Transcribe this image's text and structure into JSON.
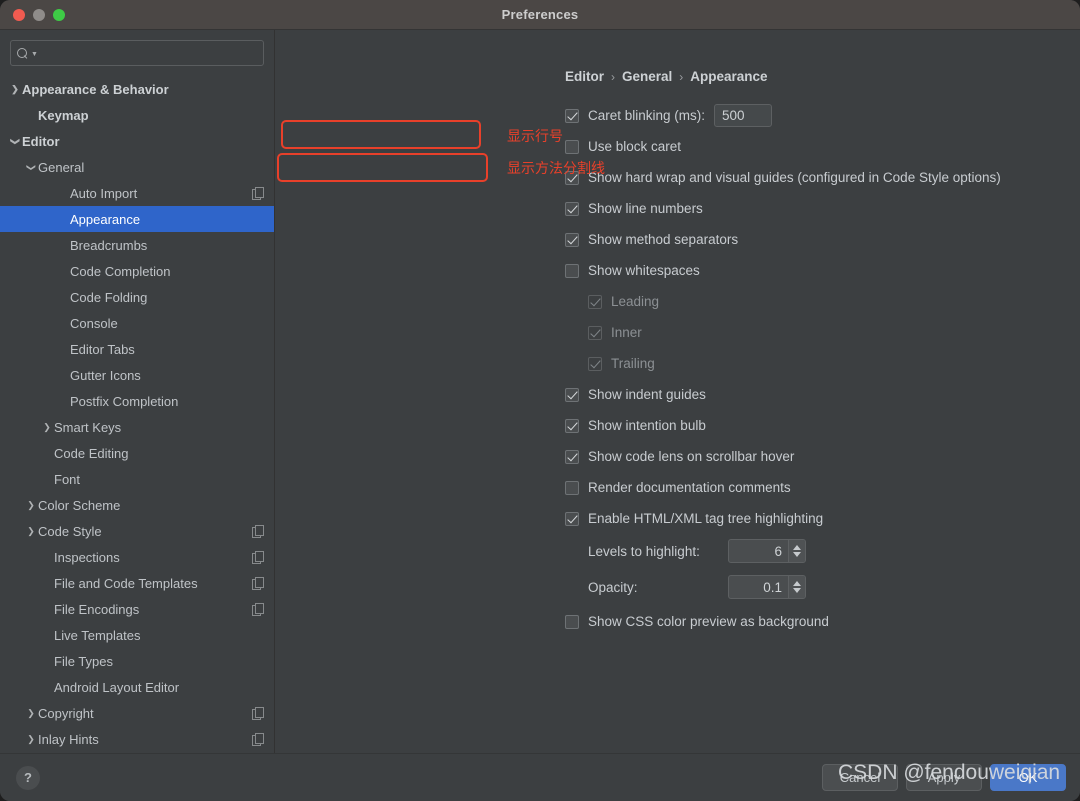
{
  "window": {
    "title": "Preferences",
    "traffic_lights": [
      "close-button",
      "minimize-button",
      "zoom-button"
    ]
  },
  "sidebar": {
    "search": {
      "value": "",
      "placeholder": ""
    },
    "items": [
      {
        "label": "Appearance & Behavior",
        "indent": 0,
        "twisty": "collapsed",
        "bold": true,
        "selected": false,
        "copy_icon": false
      },
      {
        "label": "Keymap",
        "indent": 1,
        "twisty": "none",
        "bold": true,
        "selected": false,
        "copy_icon": false
      },
      {
        "label": "Editor",
        "indent": 0,
        "twisty": "expanded",
        "bold": true,
        "selected": false,
        "copy_icon": false
      },
      {
        "label": "General",
        "indent": 1,
        "twisty": "expanded",
        "bold": false,
        "selected": false,
        "copy_icon": false
      },
      {
        "label": "Auto Import",
        "indent": 3,
        "twisty": "none",
        "bold": false,
        "selected": false,
        "copy_icon": true
      },
      {
        "label": "Appearance",
        "indent": 3,
        "twisty": "none",
        "bold": false,
        "selected": true,
        "copy_icon": false
      },
      {
        "label": "Breadcrumbs",
        "indent": 3,
        "twisty": "none",
        "bold": false,
        "selected": false,
        "copy_icon": false
      },
      {
        "label": "Code Completion",
        "indent": 3,
        "twisty": "none",
        "bold": false,
        "selected": false,
        "copy_icon": false
      },
      {
        "label": "Code Folding",
        "indent": 3,
        "twisty": "none",
        "bold": false,
        "selected": false,
        "copy_icon": false
      },
      {
        "label": "Console",
        "indent": 3,
        "twisty": "none",
        "bold": false,
        "selected": false,
        "copy_icon": false
      },
      {
        "label": "Editor Tabs",
        "indent": 3,
        "twisty": "none",
        "bold": false,
        "selected": false,
        "copy_icon": false
      },
      {
        "label": "Gutter Icons",
        "indent": 3,
        "twisty": "none",
        "bold": false,
        "selected": false,
        "copy_icon": false
      },
      {
        "label": "Postfix Completion",
        "indent": 3,
        "twisty": "none",
        "bold": false,
        "selected": false,
        "copy_icon": false
      },
      {
        "label": "Smart Keys",
        "indent": 2,
        "twisty": "collapsed",
        "bold": false,
        "selected": false,
        "copy_icon": false
      },
      {
        "label": "Code Editing",
        "indent": 2,
        "twisty": "none",
        "bold": false,
        "selected": false,
        "copy_icon": false
      },
      {
        "label": "Font",
        "indent": 2,
        "twisty": "none",
        "bold": false,
        "selected": false,
        "copy_icon": false
      },
      {
        "label": "Color Scheme",
        "indent": 1,
        "twisty": "collapsed",
        "bold": false,
        "selected": false,
        "copy_icon": false
      },
      {
        "label": "Code Style",
        "indent": 1,
        "twisty": "collapsed",
        "bold": false,
        "selected": false,
        "copy_icon": true
      },
      {
        "label": "Inspections",
        "indent": 2,
        "twisty": "none",
        "bold": false,
        "selected": false,
        "copy_icon": true
      },
      {
        "label": "File and Code Templates",
        "indent": 2,
        "twisty": "none",
        "bold": false,
        "selected": false,
        "copy_icon": true
      },
      {
        "label": "File Encodings",
        "indent": 2,
        "twisty": "none",
        "bold": false,
        "selected": false,
        "copy_icon": true
      },
      {
        "label": "Live Templates",
        "indent": 2,
        "twisty": "none",
        "bold": false,
        "selected": false,
        "copy_icon": false
      },
      {
        "label": "File Types",
        "indent": 2,
        "twisty": "none",
        "bold": false,
        "selected": false,
        "copy_icon": false
      },
      {
        "label": "Android Layout Editor",
        "indent": 2,
        "twisty": "none",
        "bold": false,
        "selected": false,
        "copy_icon": false
      },
      {
        "label": "Copyright",
        "indent": 1,
        "twisty": "collapsed",
        "bold": false,
        "selected": false,
        "copy_icon": true
      },
      {
        "label": "Inlay Hints",
        "indent": 1,
        "twisty": "collapsed",
        "bold": false,
        "selected": false,
        "copy_icon": true
      }
    ]
  },
  "main": {
    "breadcrumb": [
      "Editor",
      "General",
      "Appearance"
    ],
    "breadcrumb_separator": "›",
    "caret_blinking": {
      "label": "Caret blinking (ms):",
      "checked": true,
      "value": "500"
    },
    "options": [
      {
        "label": "Use block caret",
        "checked": false,
        "disabled": false,
        "indent": 0
      },
      {
        "label": "Show hard wrap and visual guides (configured in Code Style options)",
        "checked": true,
        "disabled": false,
        "indent": 0
      },
      {
        "label": "Show line numbers",
        "checked": true,
        "disabled": false,
        "indent": 0
      },
      {
        "label": "Show method separators",
        "checked": true,
        "disabled": false,
        "indent": 0
      },
      {
        "label": "Show whitespaces",
        "checked": false,
        "disabled": false,
        "indent": 0
      },
      {
        "label": "Leading",
        "checked": true,
        "disabled": true,
        "indent": 1
      },
      {
        "label": "Inner",
        "checked": true,
        "disabled": true,
        "indent": 1
      },
      {
        "label": "Trailing",
        "checked": true,
        "disabled": true,
        "indent": 1
      },
      {
        "label": "Show indent guides",
        "checked": true,
        "disabled": false,
        "indent": 0
      },
      {
        "label": "Show intention bulb",
        "checked": true,
        "disabled": false,
        "indent": 0
      },
      {
        "label": "Show code lens on scrollbar hover",
        "checked": true,
        "disabled": false,
        "indent": 0
      },
      {
        "label": "Render documentation comments",
        "checked": false,
        "disabled": false,
        "indent": 0
      },
      {
        "label": "Enable HTML/XML tag tree highlighting",
        "checked": true,
        "disabled": false,
        "indent": 0
      }
    ],
    "spinners": [
      {
        "label": "Levels to highlight:",
        "value": "6"
      },
      {
        "label": "Opacity:",
        "value": "0.1"
      }
    ],
    "css_preview": {
      "label": "Show CSS color preview as background",
      "checked": false
    }
  },
  "annotations": {
    "color": "#e8402a",
    "notes": [
      {
        "text": "显示行号"
      },
      {
        "text": "显示方法分割线"
      }
    ]
  },
  "footer": {
    "help_label": "?",
    "buttons": [
      {
        "label": "Cancel",
        "primary": false
      },
      {
        "label": "Apply",
        "primary": false
      },
      {
        "label": "OK",
        "primary": true
      }
    ]
  },
  "watermark": {
    "text": "CSDN @fendouweiqian"
  }
}
